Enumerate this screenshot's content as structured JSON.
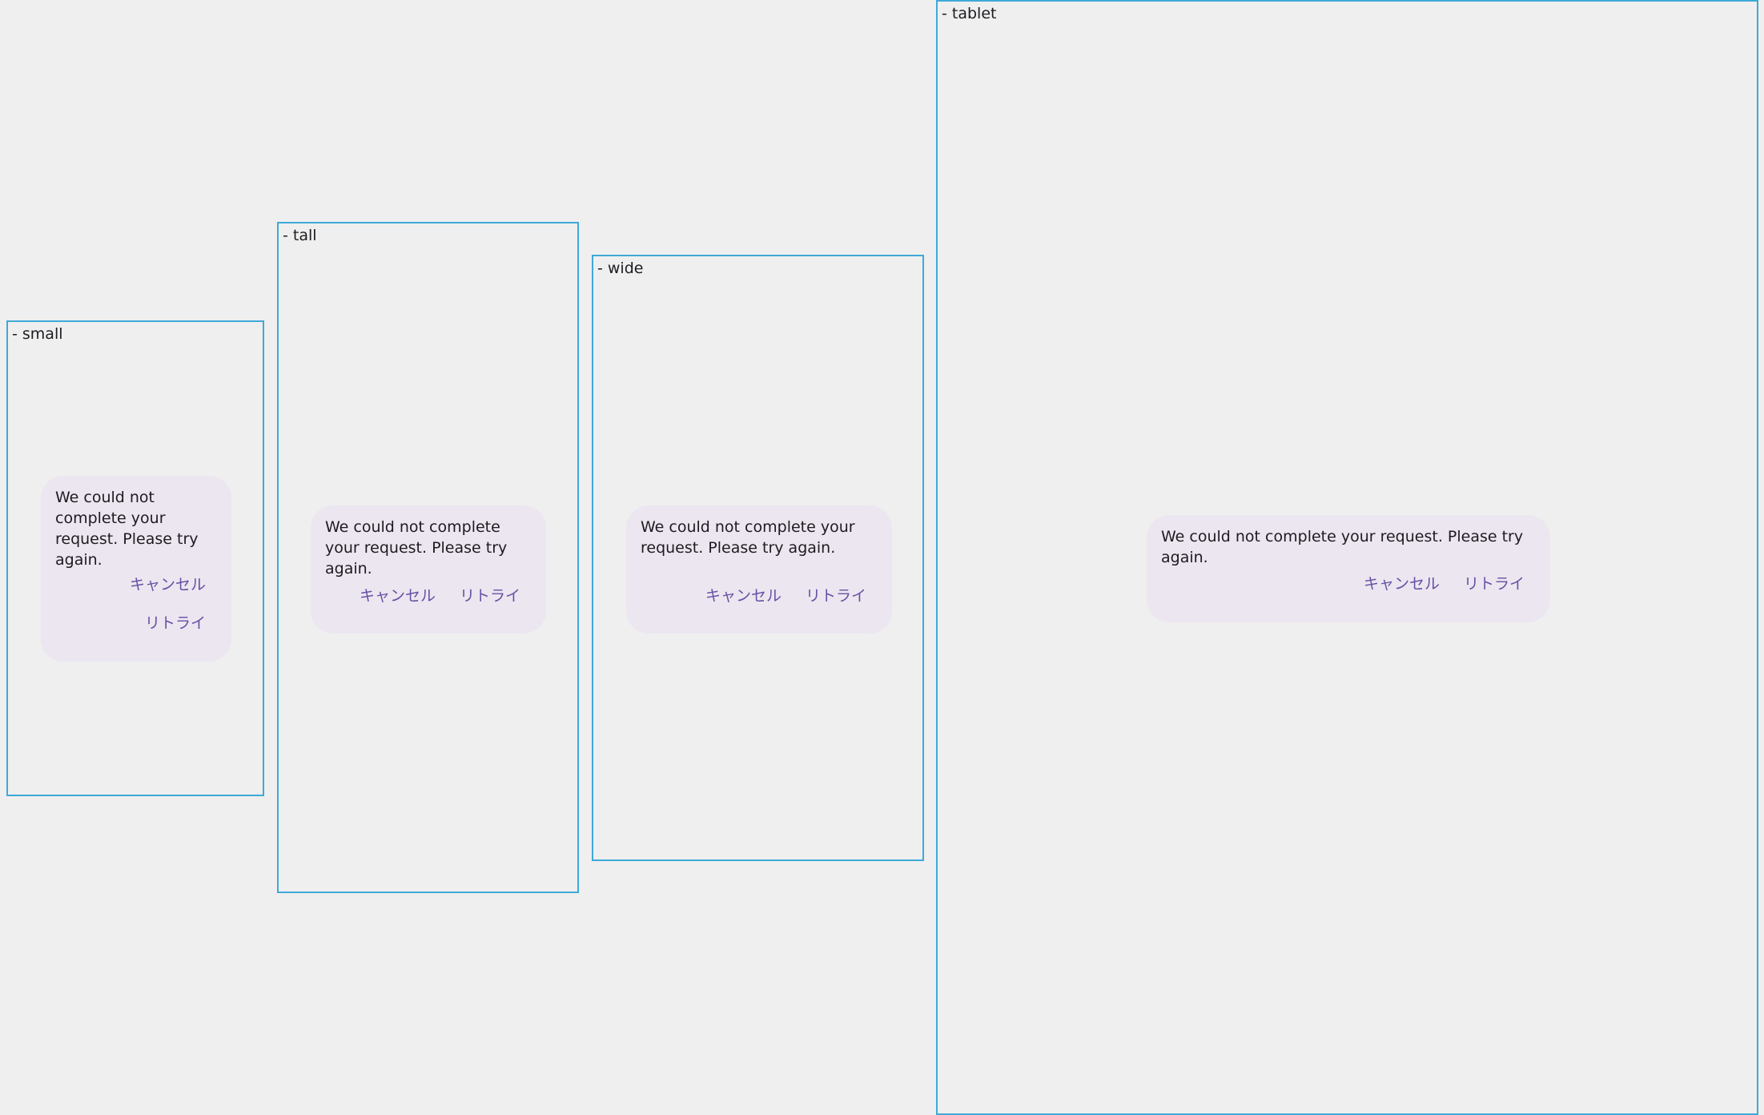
{
  "frames": {
    "small": {
      "label": "- small",
      "message": "We could not complete your request. Please try again.",
      "cancel_label": "キャンセル",
      "retry_label": "リトライ"
    },
    "tall": {
      "label": "- tall",
      "message": "We could not complete your request. Please try again.",
      "cancel_label": "キャンセル",
      "retry_label": "リトライ"
    },
    "wide": {
      "label": "- wide",
      "message": "We could not complete your request. Please try again.",
      "cancel_label": "キャンセル",
      "retry_label": "リトライ"
    },
    "tablet": {
      "label": "- tablet",
      "message": "We could not complete your request. Please try again.",
      "cancel_label": "キャンセル",
      "retry_label": "リトライ"
    }
  },
  "colors": {
    "background": "#efefef",
    "frame_border": "#3fa9d8",
    "dialog_surface": "#ece6f0",
    "button_text": "#6750a4",
    "body_text": "#1d1b20"
  }
}
